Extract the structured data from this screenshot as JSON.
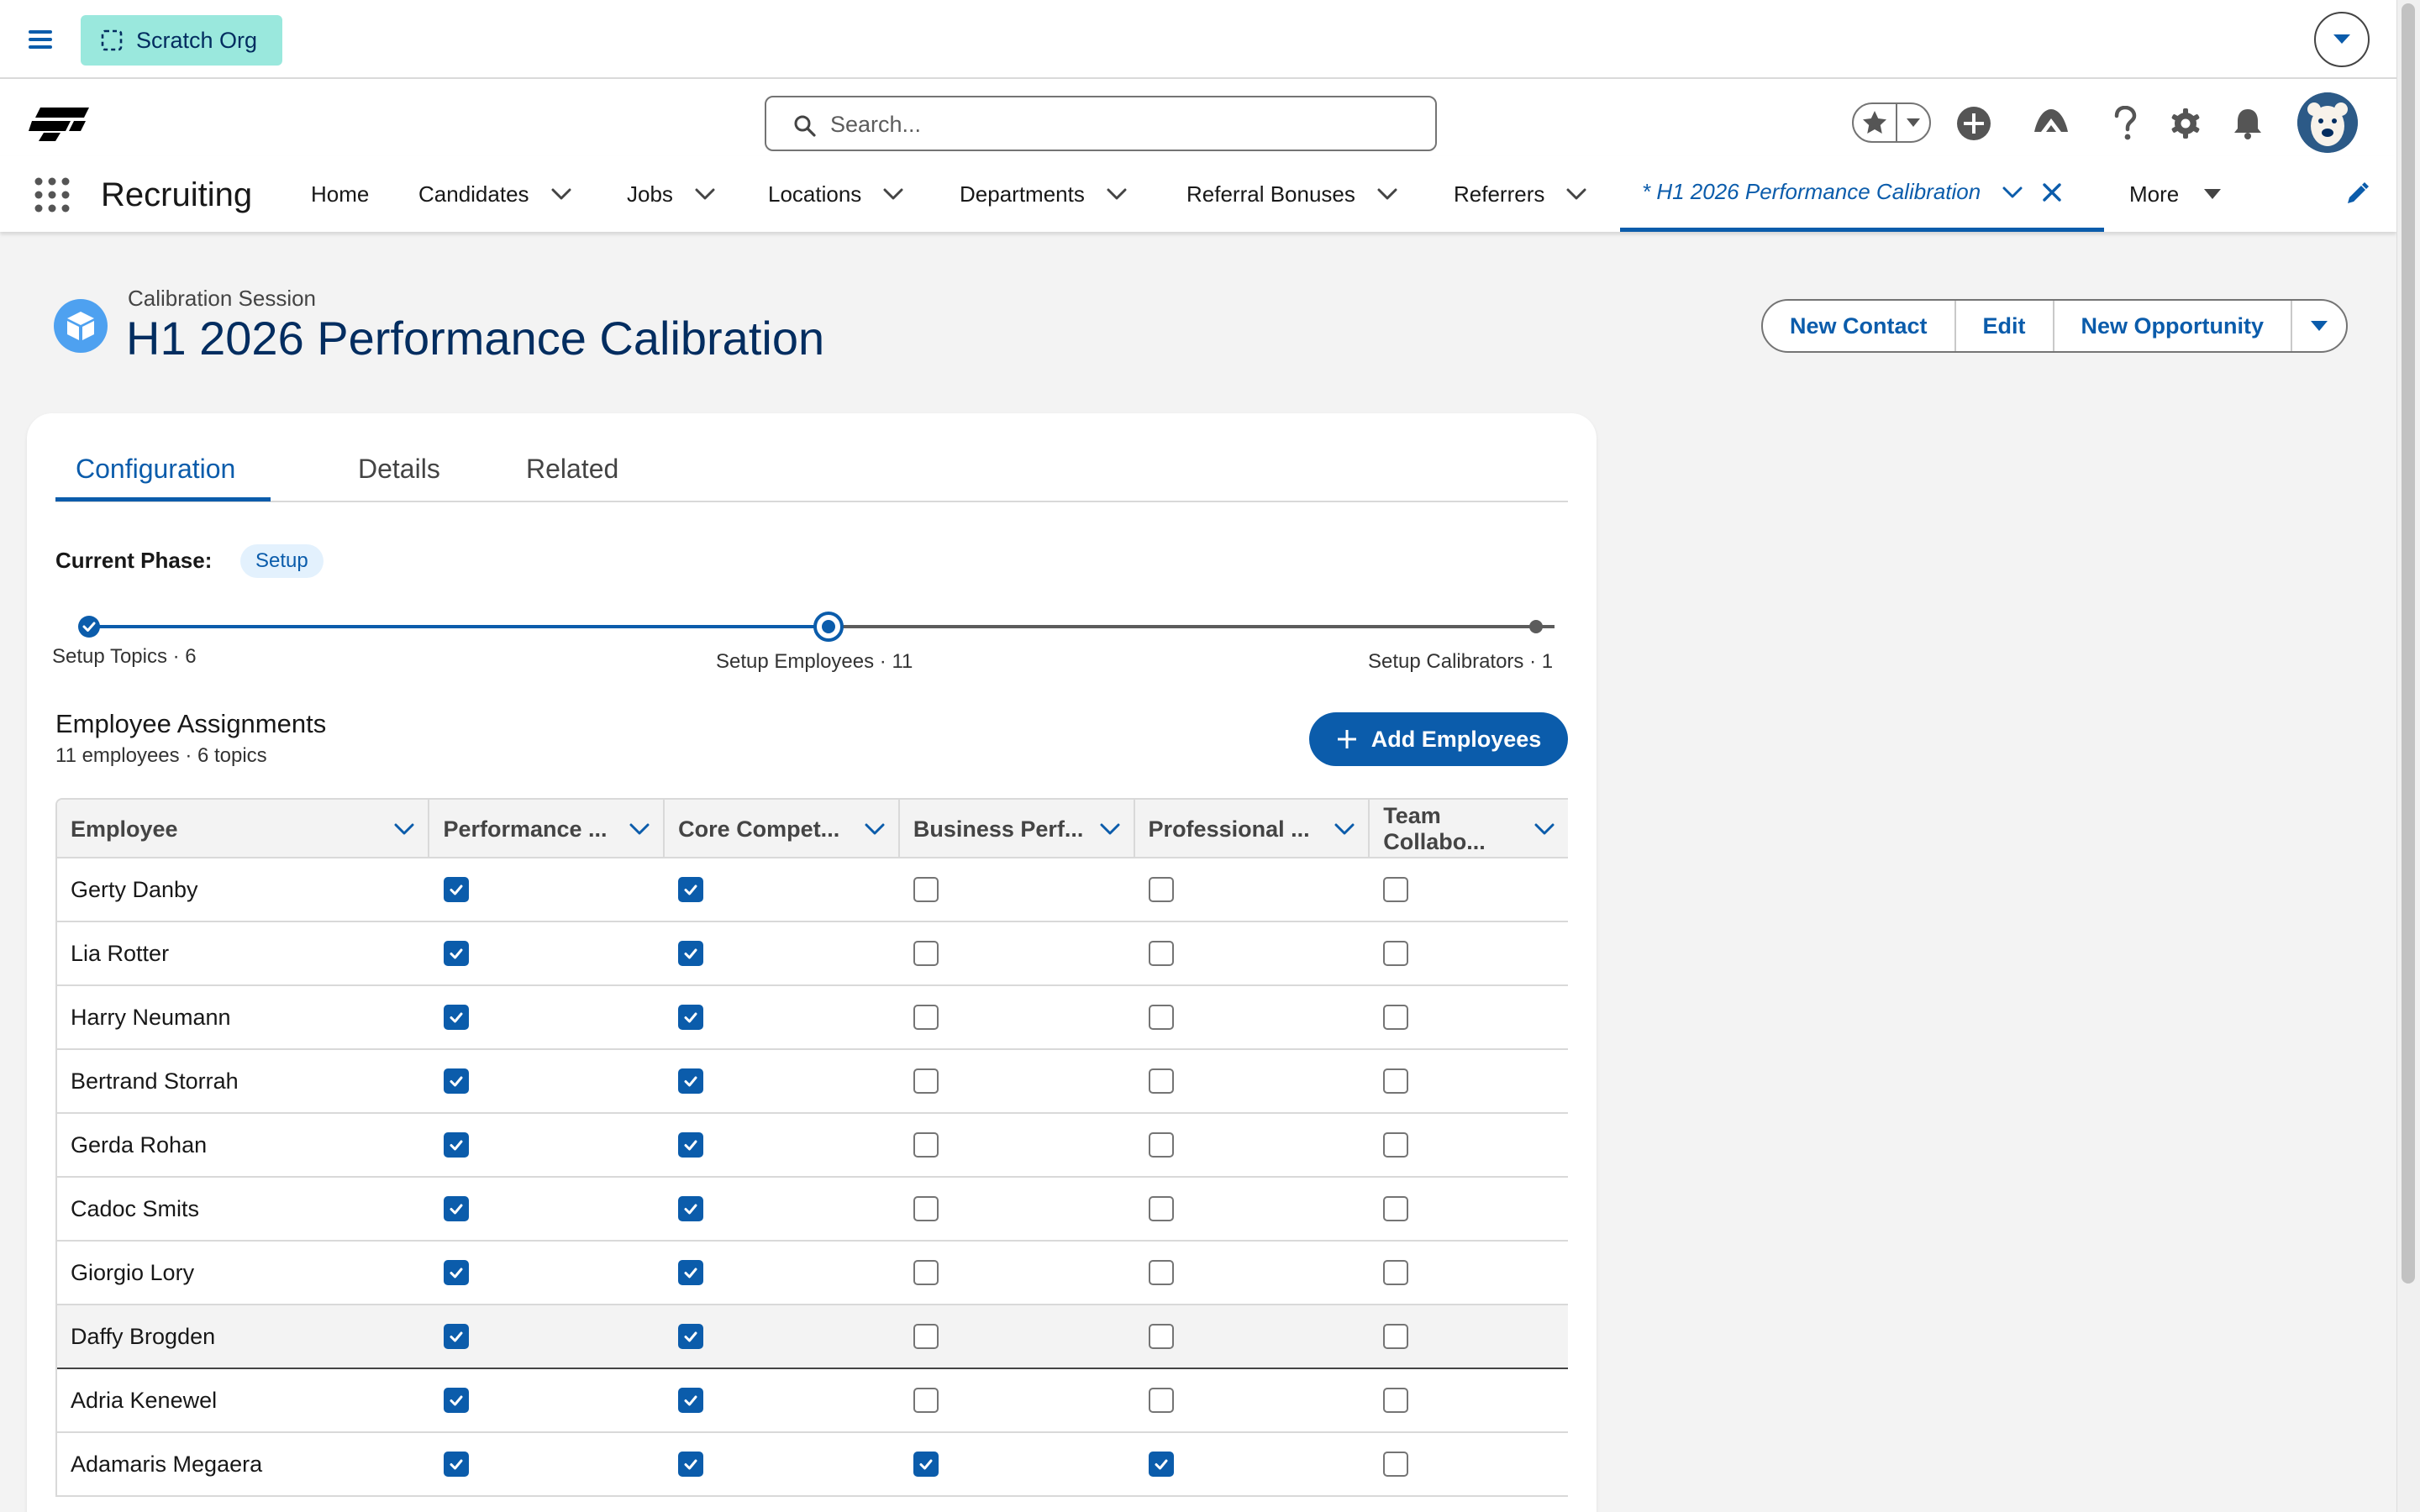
{
  "topbar": {
    "org_label": "Scratch Org",
    "icons": [
      "menu-icon",
      "dashed-square-icon",
      "chevron-down-icon"
    ]
  },
  "header": {
    "search_placeholder": "Search...",
    "icons": [
      "brand-logo",
      "search-icon",
      "star-icon",
      "add-icon",
      "trailhead-icon",
      "help-icon",
      "gear-icon",
      "bell-icon",
      "bear-avatar"
    ]
  },
  "nav": {
    "app_name": "Recruiting",
    "items": [
      {
        "label": "Home",
        "has_menu": false
      },
      {
        "label": "Candidates",
        "has_menu": true
      },
      {
        "label": "Jobs",
        "has_menu": true
      },
      {
        "label": "Locations",
        "has_menu": true
      },
      {
        "label": "Departments",
        "has_menu": true
      },
      {
        "label": "Referral Bonuses",
        "has_menu": true
      },
      {
        "label": "Referrers",
        "has_menu": true
      }
    ],
    "active_tab": "* H1 2026 Performance Calibration",
    "more_label": "More"
  },
  "record": {
    "object_type": "Calibration Session",
    "title": "H1 2026 Performance Calibration",
    "actions": [
      "New Contact",
      "Edit",
      "New Opportunity"
    ]
  },
  "tabs": [
    "Configuration",
    "Details",
    "Related"
  ],
  "active_tab_index": 0,
  "phase": {
    "label": "Current Phase:",
    "value": "Setup",
    "steps": [
      {
        "label": "Setup Topics · 6",
        "status": "complete"
      },
      {
        "label": "Setup Employees · 11",
        "status": "current"
      },
      {
        "label": "Setup Calibrators · 1",
        "status": "upcoming"
      }
    ]
  },
  "assignments": {
    "title": "Employee Assignments",
    "subtitle": "11 employees · 6 topics",
    "add_button": "Add Employees",
    "columns": [
      "Employee",
      "Performance ...",
      "Core Compet...",
      "Business Perf...",
      "Professional ...",
      "Team Collabo..."
    ],
    "rows": [
      {
        "name": "Gerty Danby",
        "checks": [
          true,
          true,
          false,
          false,
          false
        ]
      },
      {
        "name": "Lia Rotter",
        "checks": [
          true,
          true,
          false,
          false,
          false
        ]
      },
      {
        "name": "Harry Neumann",
        "checks": [
          true,
          true,
          false,
          false,
          false
        ]
      },
      {
        "name": "Bertrand Storrah",
        "checks": [
          true,
          true,
          false,
          false,
          false
        ]
      },
      {
        "name": "Gerda Rohan",
        "checks": [
          true,
          true,
          false,
          false,
          false
        ]
      },
      {
        "name": "Cadoc Smits",
        "checks": [
          true,
          true,
          false,
          false,
          false
        ]
      },
      {
        "name": "Giorgio Lory",
        "checks": [
          true,
          true,
          false,
          false,
          false
        ]
      },
      {
        "name": "Daffy Brogden",
        "checks": [
          true,
          true,
          false,
          false,
          false
        ],
        "highlighted": true
      },
      {
        "name": "Adria Kenewel",
        "checks": [
          true,
          true,
          false,
          false,
          false
        ]
      },
      {
        "name": "Adamaris Megaera",
        "checks": [
          true,
          true,
          true,
          true,
          false
        ]
      }
    ]
  },
  "colors": {
    "brand": "#0b5cab",
    "title": "#032d60",
    "scratch_org_bg": "#9ae8dd",
    "page_bg": "#f3f3f3",
    "record_icon": "#4ea1f0"
  }
}
